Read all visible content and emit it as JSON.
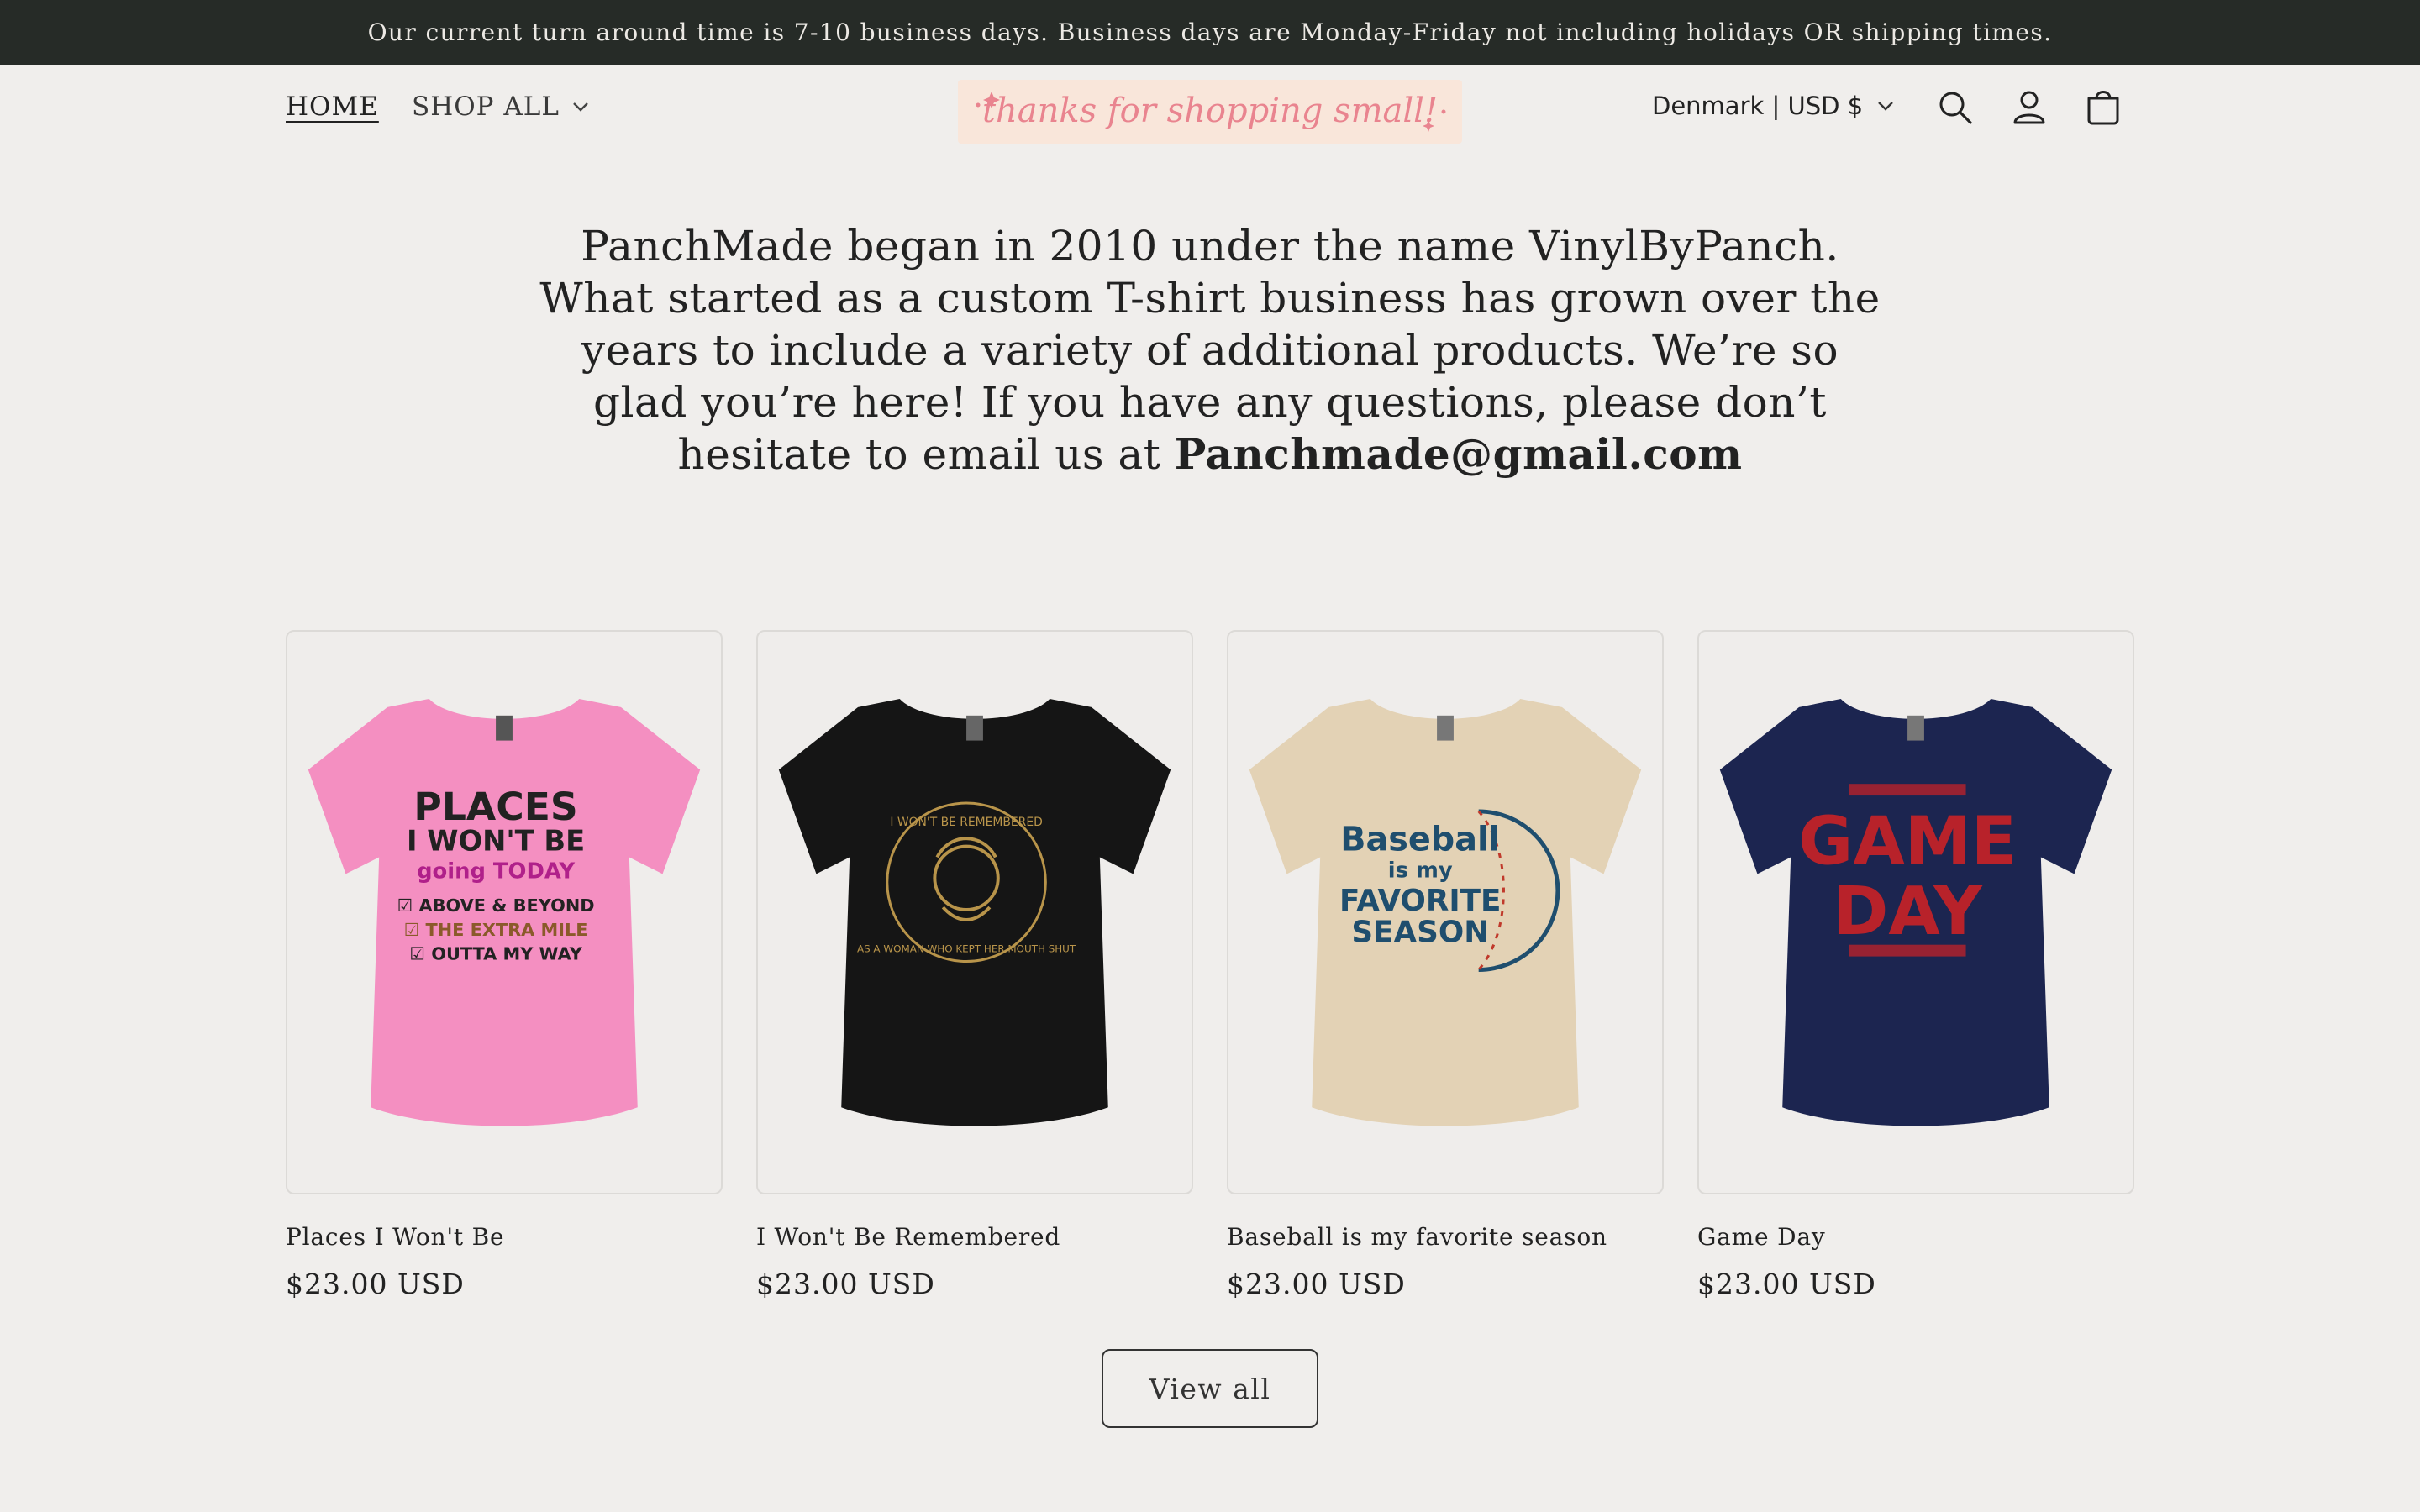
{
  "announcement": "Our current turn around time is 7-10 business days. Business days are Monday-Friday not including holidays OR shipping times.",
  "nav": {
    "home": "HOME",
    "shop_all": "SHOP ALL"
  },
  "logo_text": "thanks for shopping small!",
  "country_selector": "Denmark | USD $",
  "intro": {
    "text": "PanchMade began in 2010 under the name VinylByPanch. What started as a custom T-shirt business has grown over the years to include a variety of additional products. We’re so glad you’re here! If you have any questions, please don’t hesitate to email us at ",
    "email": "Panchmade@gmail.com"
  },
  "products": [
    {
      "title": "Places I Won't Be",
      "price": "$23.00 USD",
      "shirt_color": "#f48fc1",
      "print_lines": [
        "PLACES",
        "I WON'T BE",
        "going TODAY",
        "☑ ABOVE & BEYOND",
        "☑ THE EXTRA MILE",
        "☑ OUTTA MY WAY"
      ]
    },
    {
      "title": "I Won't Be Remembered",
      "price": "$23.00 USD",
      "shirt_color": "#151515",
      "print_lines": [
        "I WON'T BE REMEMBERED",
        "AS A WOMAN WHO KEPT HER MOUTH SHUT"
      ]
    },
    {
      "title": "Baseball is my favorite season",
      "price": "$23.00 USD",
      "shirt_color": "#e3d2b5",
      "print_lines": [
        "Baseball",
        "is my",
        "FAVORITE",
        "SEASON"
      ]
    },
    {
      "title": "Game Day",
      "price": "$23.00 USD",
      "shirt_color": "#1c2550",
      "print_lines": [
        "GAME",
        "DAY"
      ]
    }
  ],
  "view_all": "View all",
  "colors": {
    "announcement_bg": "#262b27",
    "page_bg": "#f0eeec",
    "logo_bg": "#f9e6da",
    "logo_text": "#e9848f"
  }
}
